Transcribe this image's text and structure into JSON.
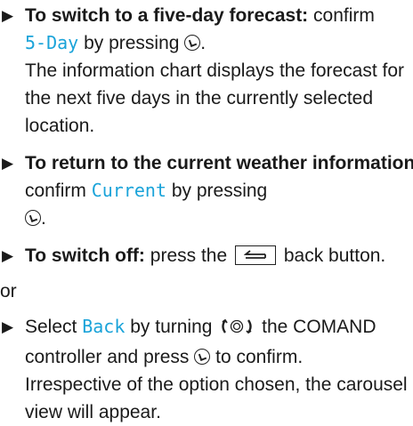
{
  "steps": [
    {
      "bold": "To switch to a five-day forecast:",
      "pre": "confirm",
      "option": "5-Day",
      "post": "by pressing",
      "end": ".",
      "note": "The information chart displays the forecast for the next five days in the currently selected location."
    },
    {
      "bold": "To return to the current weather information:",
      "pre": "confirm",
      "option": "Current",
      "post": "by pressing",
      "end": "."
    },
    {
      "bold": "To switch off:",
      "pre": "press the",
      "post": "back button."
    }
  ],
  "or_text": "or",
  "last_step": {
    "pre": "Select",
    "option": "Back",
    "mid": "by turning",
    "mid2": "the COMAND controller and press",
    "post": "to confirm.",
    "note": "Irrespective of the option chosen, the carousel view will appear."
  },
  "icons": {
    "bullet": "triangle-right-icon",
    "press": "press-button-icon",
    "back": "back-button-icon",
    "rotate": "rotate-controller-icon"
  }
}
